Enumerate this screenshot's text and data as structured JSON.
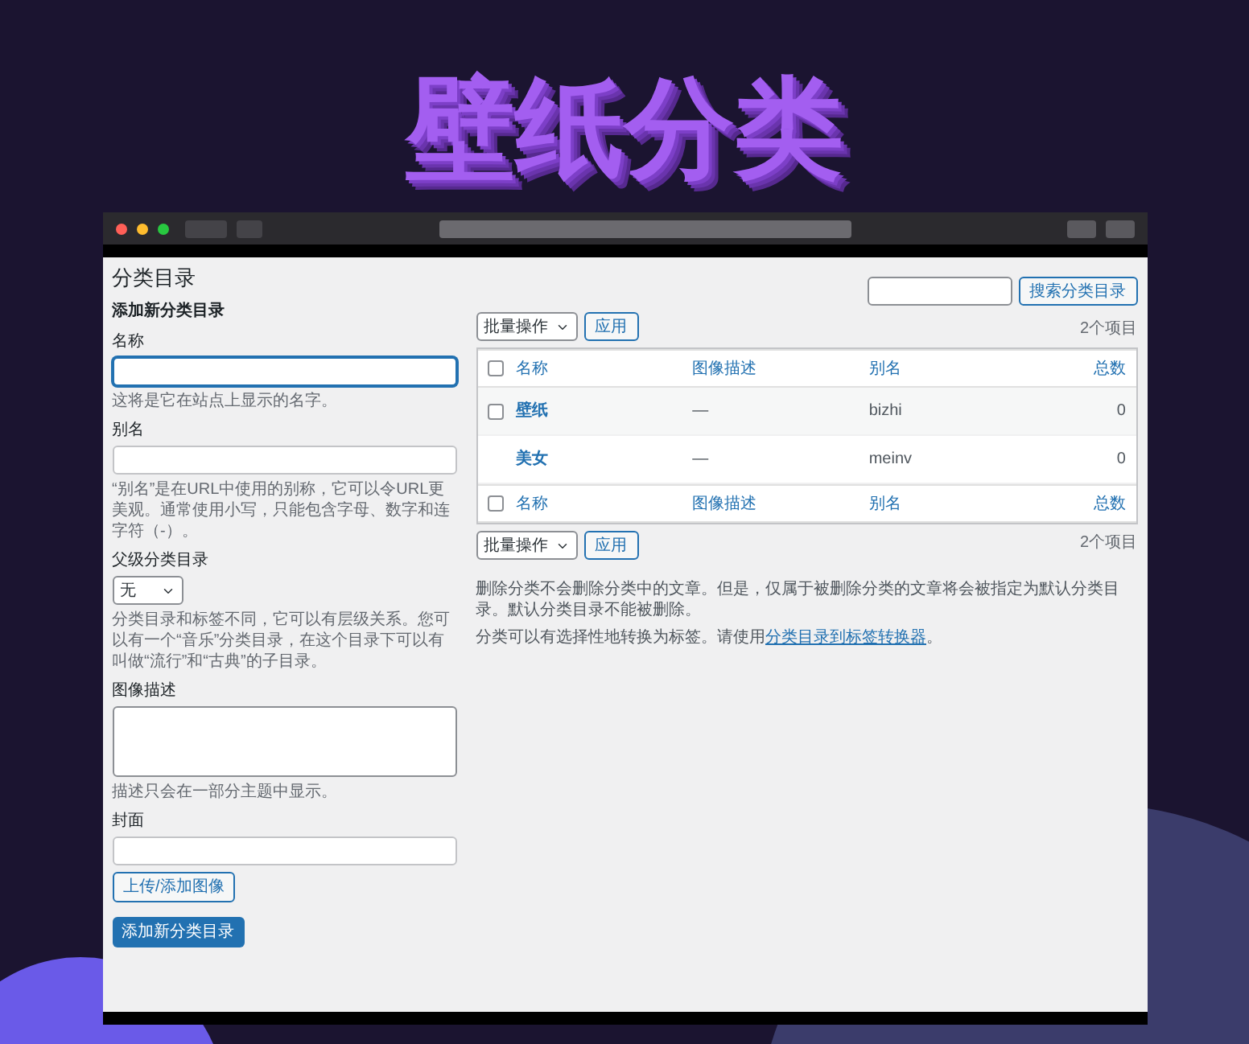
{
  "title": "壁纸分类",
  "page_heading": "分类目录",
  "add_form": {
    "heading": "添加新分类目录",
    "fields": [
      {
        "kind": "text",
        "label": "名称",
        "focused": true,
        "hint": "这将是它在站点上显示的名字。"
      },
      {
        "kind": "text",
        "label": "别名",
        "focused": false,
        "hint": "“别名”是在URL中使用的别称，它可以令URL更美观。通常使用小写，只能包含字母、数字和连字符（-）。"
      },
      {
        "kind": "select",
        "label": "父级分类目录",
        "value": "无",
        "hint": "分类目录和标签不同，它可以有层级关系。您可以有一个“音乐”分类目录，在这个目录下可以有叫做“流行”和“古典”的子目录。"
      },
      {
        "kind": "textarea",
        "label": "图像描述",
        "hint": "描述只会在一部分主题中显示。"
      },
      {
        "kind": "image",
        "label": "封面",
        "button": "上传/添加图像"
      }
    ],
    "submit": "添加新分类目录"
  },
  "search": {
    "button": "搜索分类目录"
  },
  "top_count": "2个项目",
  "bulk_top": {
    "select": "批量操作",
    "apply": "应用"
  },
  "header_checked": false,
  "columns": [
    "名称",
    "图像描述",
    "别名",
    "总数"
  ],
  "rows": [
    {
      "checked": false,
      "name": "壁纸",
      "description": "—",
      "slug": "bizhi",
      "count": "0"
    },
    {
      "name": "美女",
      "description": "—",
      "slug": "meinv",
      "count": "0"
    }
  ],
  "footer_checked": false,
  "footer_columns": [
    "名称",
    "图像描述",
    "别名",
    "总数"
  ],
  "bulk_bottom": {
    "select": "批量操作",
    "apply": "应用"
  },
  "bottom_count": "2个项目",
  "notes": [
    {
      "text": "删除分类不会删除分类中的文章。但是，仅属于被删除分类的文章将会被指定为默认分类目录。默认分类目录不能被删除。"
    },
    {
      "text": "分类可以有选择性地转换为标签。请使用",
      "link": "分类目录到标签转换器",
      "after": "。"
    }
  ]
}
